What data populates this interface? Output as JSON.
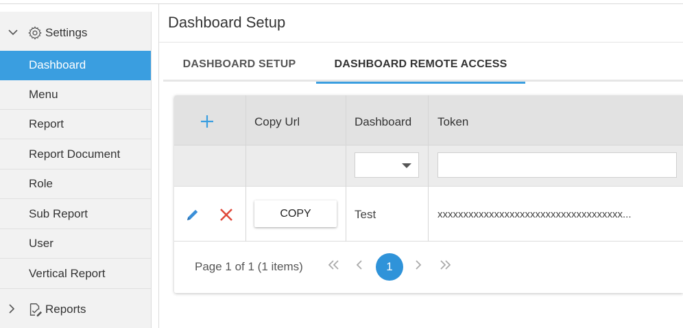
{
  "sidebar": {
    "settings_label": "Settings",
    "items": [
      {
        "label": "Dashboard",
        "active": true
      },
      {
        "label": "Menu"
      },
      {
        "label": "Report"
      },
      {
        "label": "Report Document"
      },
      {
        "label": "Role"
      },
      {
        "label": "Sub Report"
      },
      {
        "label": "User"
      },
      {
        "label": "Vertical Report"
      }
    ],
    "reports_label": "Reports"
  },
  "page": {
    "title": "Dashboard Setup"
  },
  "tabs": [
    {
      "label": "DASHBOARD SETUP",
      "active": false
    },
    {
      "label": "DASHBOARD REMOTE ACCESS",
      "active": true
    }
  ],
  "grid": {
    "columns": [
      "Copy Url",
      "Dashboard",
      "Token"
    ],
    "rows": [
      {
        "copy_label": "COPY",
        "dashboard": "Test",
        "token": "xxxxxxxxxxxxxxxxxxxxxxxxxxxxxxxxxxxx..."
      }
    ],
    "filter": {
      "dashboard_value": "",
      "token_value": ""
    }
  },
  "pager": {
    "info": "Page 1 of 1 (1 items)",
    "current_page": "1"
  },
  "colors": {
    "accent": "#3a9ee0",
    "delete": "#e0493a"
  }
}
